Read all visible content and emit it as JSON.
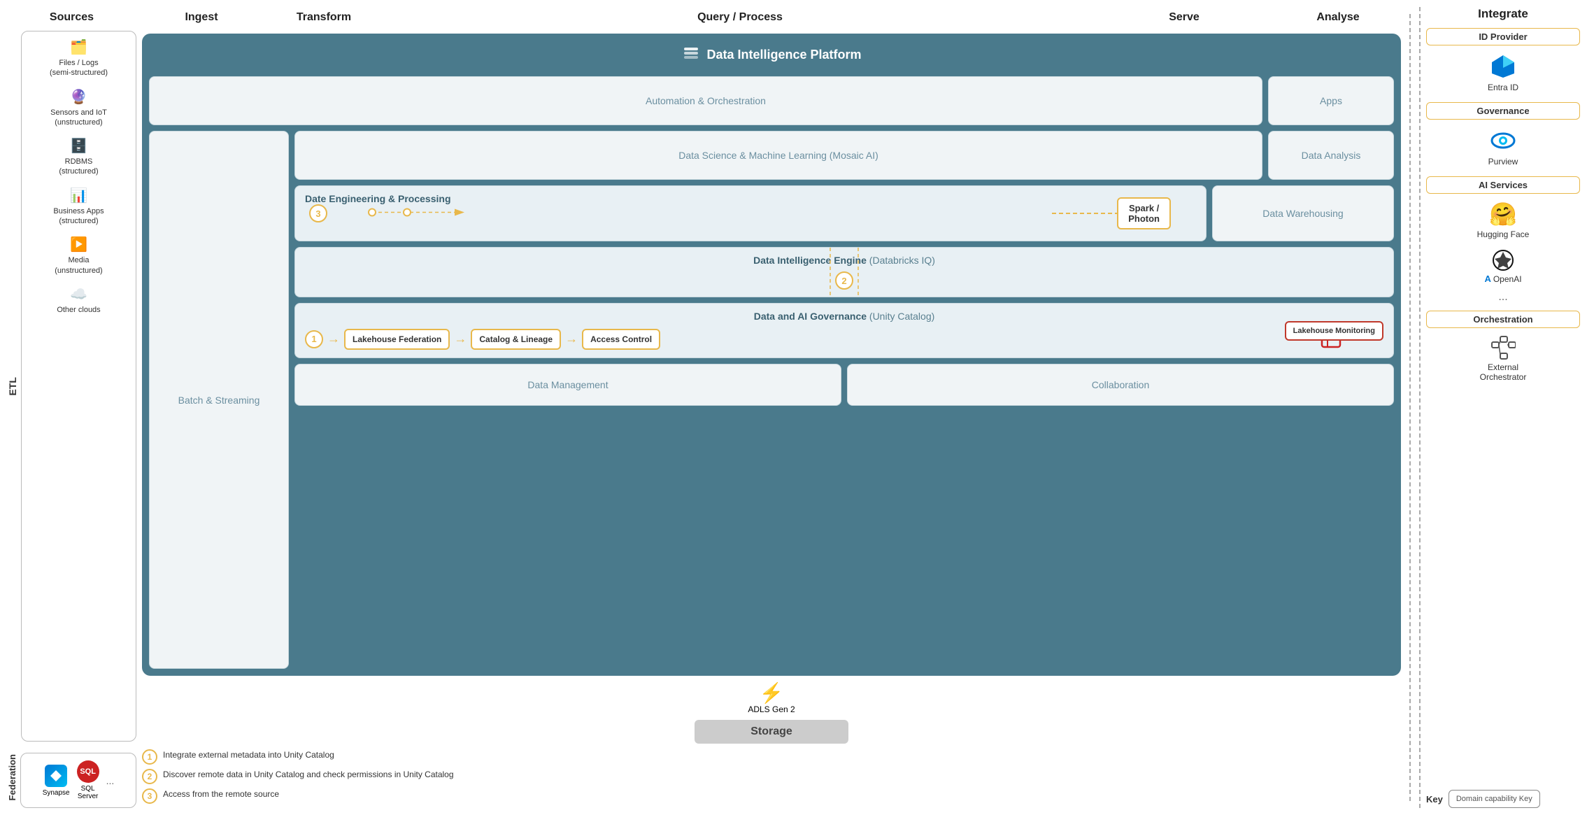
{
  "header": {
    "columns": [
      "Sources",
      "Ingest",
      "Transform",
      "Query / Process",
      "Serve",
      "Analyse"
    ]
  },
  "platform": {
    "title": "Data Intelligence Platform",
    "rows": {
      "automation": "Automation & Orchestration",
      "apps": "Apps",
      "batchStreaming": "Batch & Streaming",
      "dataScience": "Data Science & Machine Learning  (Mosaic AI)",
      "dataAnalysis": "Data Analysis",
      "dateEngineering": "Date Engineering & Processing",
      "sparkPhoton": "Spark /\nPhoton",
      "dataWarehousing": "Data Warehousing",
      "engineTitle": "Data Intelligence Engine",
      "engineSubtitle": "(Databricks IQ)",
      "governanceTitle": "Data and AI Governance",
      "governanceSubtitle": "(Unity Catalog)",
      "lakehouseFederation": "Lakehouse\nFederation",
      "catalogLineage": "Catalog &\nLineage",
      "accessControl": "Access\nControl",
      "lakhouseMonitoring": "Lakehouse\nMonitoring",
      "dataManagement": "Data Management",
      "collaboration": "Collaboration"
    }
  },
  "sources": {
    "title": "Sources",
    "items": [
      {
        "icon": "🗂️",
        "label": "Files / Logs\n(semi-structured)"
      },
      {
        "icon": "📡",
        "label": "Sensors and IoT\n(unstructured)"
      },
      {
        "icon": "🗄️",
        "label": "RDBMS\n(structured)"
      },
      {
        "icon": "📊",
        "label": "Business Apps\n(structured)"
      },
      {
        "icon": "▶️",
        "label": "Media\n(unstructured)"
      },
      {
        "icon": "☁️",
        "label": "Other clouds"
      }
    ]
  },
  "etlLabel": "ETL",
  "federationLabel": "Federation",
  "federationItems": [
    {
      "icon": "💠",
      "label": "Synapse"
    },
    {
      "icon": "🗃️",
      "label": "SQL\nServer"
    },
    {
      "label": "..."
    }
  ],
  "storage": {
    "adlsIcon": "⚡",
    "adlsLabel": "ADLS Gen 2",
    "storageLabel": "Storage"
  },
  "integrate": {
    "title": "Integrate",
    "groups": [
      {
        "label": "ID Provider",
        "borderColor": "#e8b84b",
        "items": [
          {
            "icon": "◆",
            "name": "Entra ID",
            "iconColor": "#0078d4"
          }
        ]
      },
      {
        "label": "Governance",
        "borderColor": "#e8b84b",
        "items": [
          {
            "icon": "👁️",
            "name": "Purview",
            "iconColor": "#0078d4"
          }
        ]
      },
      {
        "label": "AI Services",
        "borderColor": "#e8b84b",
        "items": [
          {
            "icon": "🤗",
            "name": "Hugging Face"
          },
          {
            "icon": "⚙️",
            "name": "OpenAI",
            "iconColor": "#111"
          },
          {
            "label": "..."
          }
        ]
      },
      {
        "label": "Orchestration",
        "borderColor": "#e8b84b",
        "items": [
          {
            "icon": "🔧",
            "name": "External\nOrchestrator"
          }
        ]
      }
    ]
  },
  "legend": {
    "title": "Key",
    "domainCapability": "Domain\ncapability Key",
    "notes": [
      {
        "num": "1",
        "text": "Integrate external metadata into Unity Catalog"
      },
      {
        "num": "2",
        "text": "Discover remote data in Unity Catalog and check permissions in Unity Catalog"
      },
      {
        "num": "3",
        "text": "Access from the remote source"
      }
    ]
  }
}
